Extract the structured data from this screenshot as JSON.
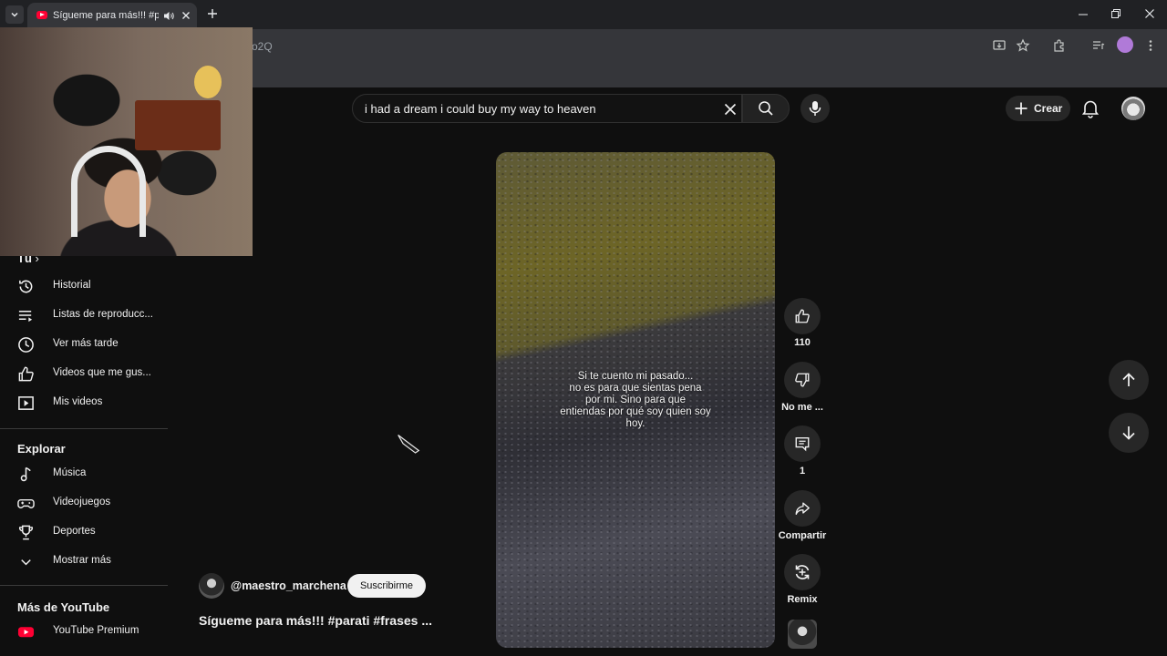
{
  "browser": {
    "tab_title": "Sígueme para más!!! #parati #frases",
    "url_fragment": "o2Q"
  },
  "header": {
    "search_query": "i had a dream i could buy my way to heaven",
    "create_label": "Crear"
  },
  "sidebar": {
    "you_label": "Tú",
    "you_items": [
      {
        "label": "Historial",
        "icon": "history-icon"
      },
      {
        "label": "Listas de reproducc...",
        "icon": "playlist-icon"
      },
      {
        "label": "Ver más tarde",
        "icon": "clock-icon"
      },
      {
        "label": "Videos que me gus...",
        "icon": "thumbs-up-icon"
      },
      {
        "label": "Mis videos",
        "icon": "my-videos-icon"
      }
    ],
    "explore_heading": "Explorar",
    "explore_items": [
      {
        "label": "Música",
        "icon": "music-note-icon"
      },
      {
        "label": "Videojuegos",
        "icon": "gamepad-icon"
      },
      {
        "label": "Deportes",
        "icon": "trophy-icon"
      },
      {
        "label": "Mostrar más",
        "icon": "chevron-down-icon"
      }
    ],
    "more_heading": "Más de YouTube",
    "more_items": [
      {
        "label": "YouTube Premium",
        "icon": "youtube-premium-icon"
      }
    ]
  },
  "video": {
    "caption": "Si te cuento mi pasado...\nno es para que sientas pena\npor mi. Sino para que\nentiendas por qué soy quien soy\nhoy.",
    "channel": "@maestro_marchena",
    "subscribe_label": "Suscribirme",
    "title": "Sígueme para más!!! #parati #frases ..."
  },
  "actions": {
    "like_count": "110",
    "dislike_label": "No me ...",
    "comment_count": "1",
    "share_label": "Compartir",
    "remix_label": "Remix"
  },
  "colors": {
    "background": "#0f0f0f",
    "youtube_red": "#ff0033",
    "chrome_dark": "#202124"
  }
}
